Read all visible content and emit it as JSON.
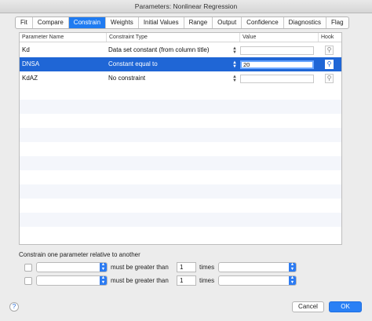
{
  "window": {
    "title": "Parameters: Nonlinear Regression"
  },
  "tabs": [
    "Fit",
    "Compare",
    "Constrain",
    "Weights",
    "Initial Values",
    "Range",
    "Output",
    "Confidence",
    "Diagnostics",
    "Flag"
  ],
  "active_tab": "Constrain",
  "table": {
    "headers": {
      "name": "Parameter Name",
      "type": "Constraint Type",
      "value": "Value",
      "hook": "Hook"
    },
    "rows": [
      {
        "name": "Kd",
        "type": "Data set constant (from column title)",
        "value": "",
        "selected": false
      },
      {
        "name": "DNSA",
        "type": "Constant equal to",
        "value": "20",
        "selected": true
      },
      {
        "name": "KdAZ",
        "type": "No constraint",
        "value": "",
        "selected": false
      }
    ]
  },
  "relation": {
    "label": "Constrain one parameter relative to another",
    "rows": [
      {
        "left": "",
        "text": "must be greater than",
        "factor": "1",
        "times": "times",
        "right": ""
      },
      {
        "left": "",
        "text": "must be greater than",
        "factor": "1",
        "times": "times",
        "right": ""
      }
    ]
  },
  "buttons": {
    "help": "?",
    "cancel": "Cancel",
    "ok": "OK"
  },
  "colors": {
    "accent": "#1f7bf1",
    "selection": "#1f66d6"
  }
}
